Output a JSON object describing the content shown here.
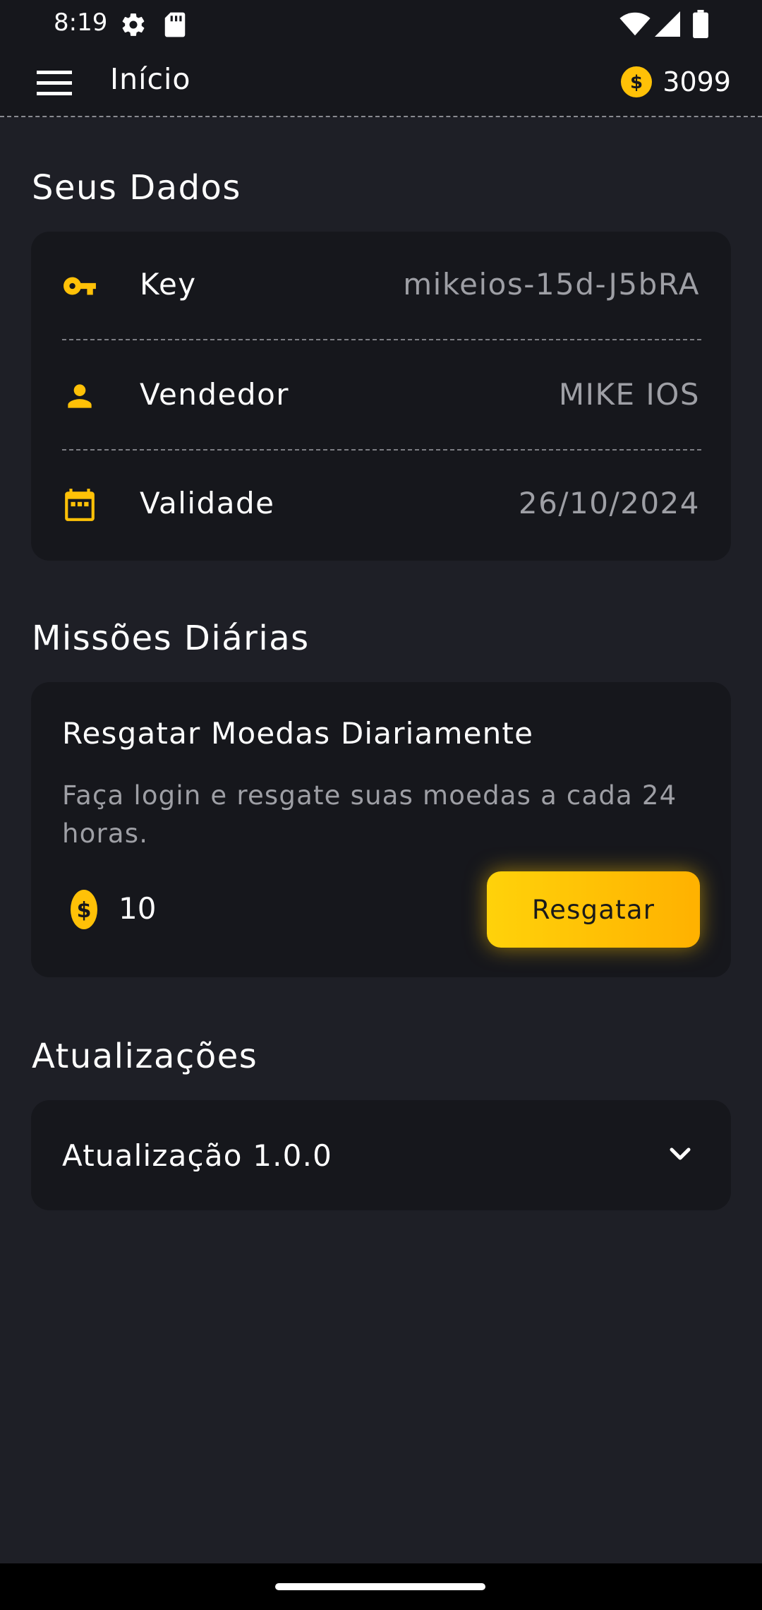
{
  "status_bar": {
    "time": "8:19",
    "icons": [
      "gear-icon",
      "sd-card-icon",
      "wifi-icon",
      "signal-icon",
      "battery-icon"
    ]
  },
  "app_bar": {
    "title": "Início",
    "coins": "3099",
    "menu_icon": "hamburger-menu-icon",
    "coin_icon": "coin-icon"
  },
  "user_data": {
    "title": "Seus Dados",
    "rows": [
      {
        "icon": "key-icon",
        "label": "Key",
        "value": "mikeios-15d-J5bRA"
      },
      {
        "icon": "person-icon",
        "label": "Vendedor",
        "value": "MIKE IOS"
      },
      {
        "icon": "calendar-icon",
        "label": "Validade",
        "value": "26/10/2024"
      }
    ]
  },
  "missions": {
    "title": "Missões Diárias",
    "items": [
      {
        "title": "Resgatar Moedas Diariamente",
        "description": "Faça login e resgate suas moedas a cada 24 horas.",
        "reward": "10",
        "button_label": "Resgatar"
      }
    ]
  },
  "updates": {
    "title": "Atualizações",
    "items": [
      {
        "title": "Atualização 1.0.0",
        "expanded": false
      }
    ]
  },
  "colors": {
    "background": "#1e1f26",
    "card": "#16171c",
    "accent": "#ffc107",
    "muted_text": "#9e9fa5"
  }
}
